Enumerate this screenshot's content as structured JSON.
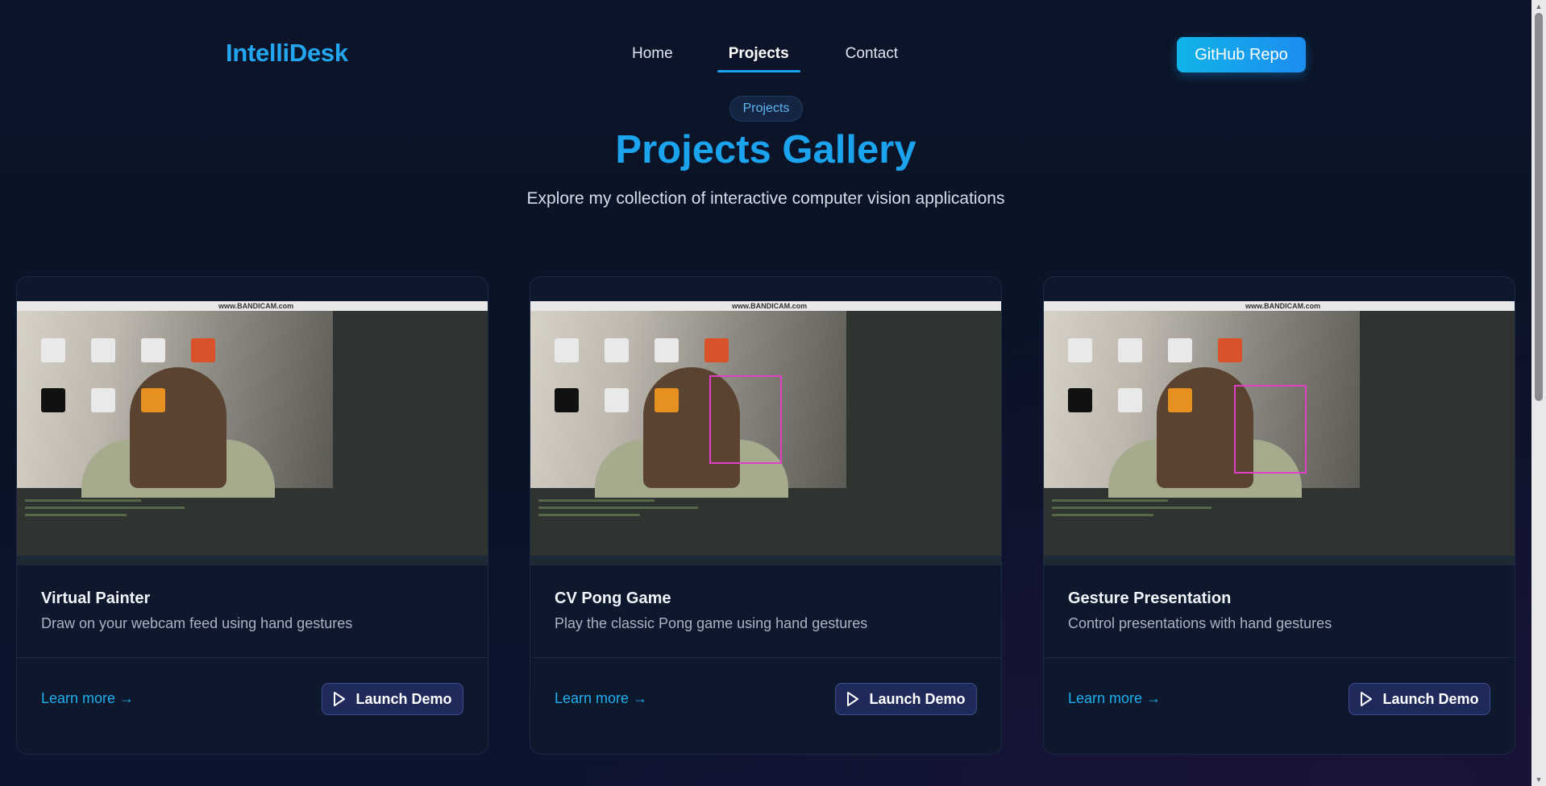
{
  "header": {
    "brand": "IntelliDesk",
    "nav": [
      {
        "label": "Home",
        "active": false
      },
      {
        "label": "Projects",
        "active": true
      },
      {
        "label": "Contact",
        "active": false
      }
    ],
    "github_button": "GitHub Repo"
  },
  "hero": {
    "pill": "Projects",
    "title": "Projects Gallery",
    "subtitle": "Explore my collection of interactive computer vision applications"
  },
  "cards": [
    {
      "title": "Virtual Painter",
      "description": "Draw on your webcam feed using hand gestures",
      "learn_more": "Learn more →",
      "demo_button": "Launch Demo",
      "watermark": "www.BANDICAM.com"
    },
    {
      "title": "CV Pong Game",
      "description": "Play the classic Pong game using hand gestures",
      "learn_more": "Learn more →",
      "demo_button": "Launch Demo",
      "watermark": "www.BANDICAM.com"
    },
    {
      "title": "Gesture Presentation",
      "description": "Control presentations with hand gestures",
      "learn_more": "Learn more →",
      "demo_button": "Launch Demo",
      "watermark": "www.BANDICAM.com"
    }
  ],
  "colors": {
    "accent": "#1ba3ee",
    "background": "#0a1224",
    "card": "#0e182d",
    "demo_button": "#1f2a5a"
  },
  "icons": {
    "demo": "play-icon",
    "scroll_up": "scroll-up-icon",
    "scroll_down": "scroll-down-icon"
  }
}
